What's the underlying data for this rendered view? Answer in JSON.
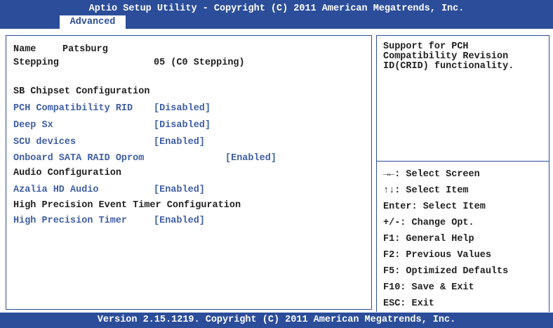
{
  "header": {
    "title": "Aptio Setup Utility - Copyright (C) 2011 American Megatrends, Inc.",
    "tabs": [
      {
        "label": "Advanced"
      }
    ]
  },
  "info": {
    "name_label": "Name",
    "name_value": "Patsburg",
    "stepping_label": "Stepping",
    "stepping_value": "05 (C0 Stepping)"
  },
  "main": {
    "sb_chipset_heading": "SB Chipset Configuration",
    "pch_crid": {
      "label": "PCH Compatibility RID",
      "value": "[Disabled]"
    },
    "deep_sx": {
      "label": "Deep Sx",
      "value": "[Disabled]"
    },
    "scu_devices": {
      "label": "SCU devices",
      "value": "[Enabled]"
    },
    "onboard_sata": {
      "label": "Onboard SATA RAID Oprom",
      "value": "[Enabled]"
    },
    "audio_heading": "Audio Configuration",
    "azalia": {
      "label": "Azalia HD Audio",
      "value": "[Enabled]"
    },
    "hpet_heading": "High Precision Event Timer Configuration",
    "hpet": {
      "label": "High Precision Timer",
      "value": "[Enabled]"
    }
  },
  "help": {
    "lines": [
      "Support for PCH",
      "Compatibility Revision",
      "ID(CRID) functionality."
    ]
  },
  "keys": {
    "select_screen": "→←: Select Screen",
    "select_item": "↑↓: Select Item",
    "enter": "Enter: Select Item",
    "change": "+/-: Change Opt.",
    "f1": "F1: General Help",
    "f2": "F2: Previous Values",
    "f5": "F5: Optimized Defaults",
    "f10": "F10: Save & Exit",
    "esc": "ESC: Exit"
  },
  "footer": {
    "version": "Version 2.15.1219. Copyright (C) 2011 American Megatrends, Inc."
  },
  "colors": {
    "bar": "#2b4d9a",
    "item_text": "#3f5ea8",
    "label_text": "#1f1f1f"
  }
}
